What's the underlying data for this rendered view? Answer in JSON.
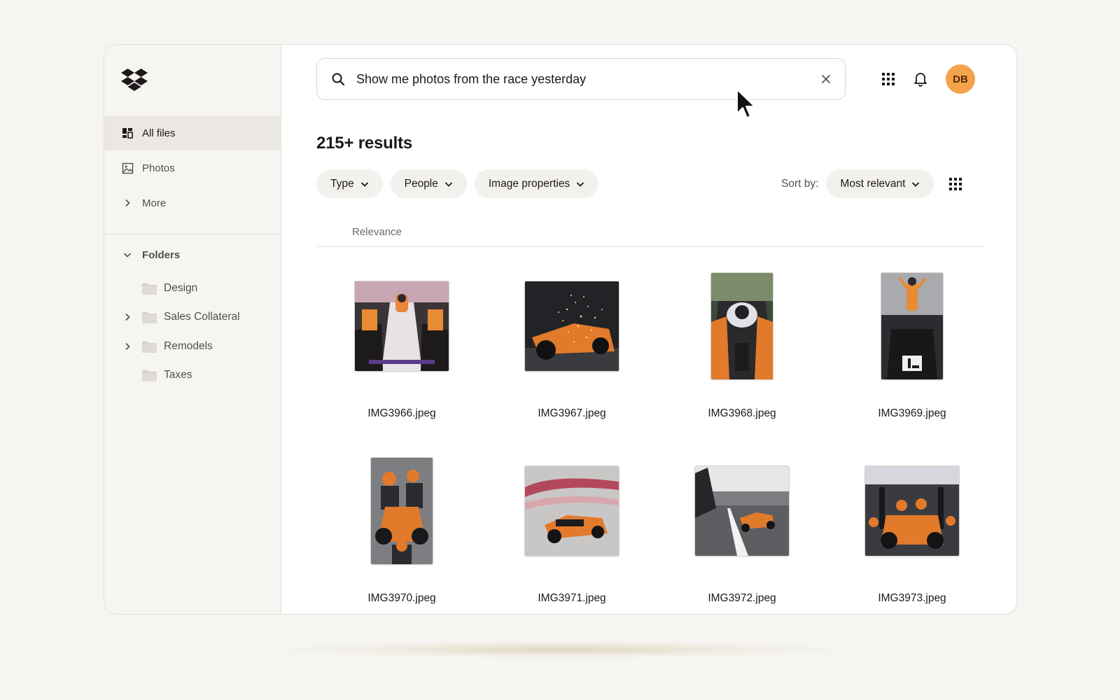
{
  "sidebar": {
    "logo": "dropbox-logo",
    "nav": [
      {
        "label": "All files",
        "icon": "all-files-icon",
        "active": true
      },
      {
        "label": "Photos",
        "icon": "photo-icon",
        "active": false
      },
      {
        "label": "More",
        "icon": "chevron-right-icon",
        "active": false
      }
    ],
    "folders_label": "Folders",
    "folders": [
      {
        "label": "Design",
        "expandable": false
      },
      {
        "label": "Sales Collateral",
        "expandable": true
      },
      {
        "label": "Remodels",
        "expandable": true
      },
      {
        "label": "Taxes",
        "expandable": false
      }
    ]
  },
  "search": {
    "value": "Show me photos from the race yesterday",
    "icon": "search-icon",
    "clear_icon": "close-icon"
  },
  "header": {
    "apps_icon": "app-grid-icon",
    "bell_icon": "bell-icon",
    "avatar_initials": "DB",
    "avatar_color": "#f4a24c"
  },
  "results": {
    "title": "215+ results",
    "filters": [
      {
        "label": "Type"
      },
      {
        "label": "People"
      },
      {
        "label": "Image properties"
      }
    ],
    "sort_label": "Sort by:",
    "sort_value": "Most relevant",
    "view_icon": "grid-view-icon",
    "column_header": "Relevance"
  },
  "files": [
    {
      "name": "IMG3966.jpeg",
      "orientation": "landscape"
    },
    {
      "name": "IMG3967.jpeg",
      "orientation": "landscape"
    },
    {
      "name": "IMG3968.jpeg",
      "orientation": "portrait"
    },
    {
      "name": "IMG3969.jpeg",
      "orientation": "portrait"
    },
    {
      "name": "IMG3970.jpeg",
      "orientation": "portrait"
    },
    {
      "name": "IMG3971.jpeg",
      "orientation": "landscape"
    },
    {
      "name": "IMG3972.jpeg",
      "orientation": "landscape"
    },
    {
      "name": "IMG3973.jpeg",
      "orientation": "landscape"
    }
  ],
  "colors": {
    "accent_orange": "#f4a24c",
    "active_nav_bg": "#ebe8e3",
    "chip_bg": "#f3f1ed"
  }
}
